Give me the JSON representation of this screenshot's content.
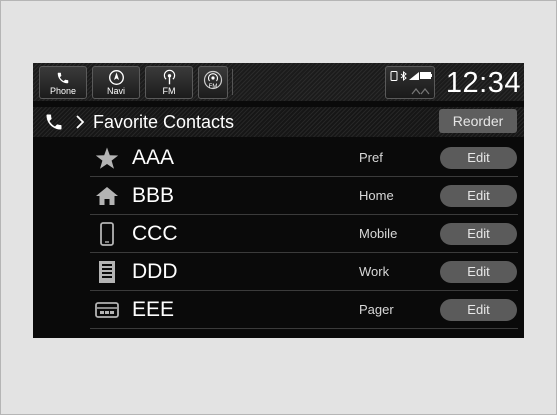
{
  "topbar": {
    "apps": [
      {
        "label": "Phone",
        "icon": "phone-icon"
      },
      {
        "label": "Navi",
        "icon": "navi-icon"
      },
      {
        "label": "FM",
        "icon": "radio-icon"
      },
      {
        "label": "FM",
        "icon": "radio-icon"
      }
    ],
    "status_icons": [
      "bluetooth-icon",
      "signal-icon",
      "battery-icon"
    ],
    "clock": "12:34"
  },
  "header": {
    "title": "Favorite Contacts",
    "reorder_label": "Reorder"
  },
  "contacts": [
    {
      "name": "AAA",
      "type": "Pref",
      "icon": "star-icon",
      "edit": "Edit"
    },
    {
      "name": "BBB",
      "type": "Home",
      "icon": "home-icon",
      "edit": "Edit"
    },
    {
      "name": "CCC",
      "type": "Mobile",
      "icon": "mobile-icon",
      "edit": "Edit"
    },
    {
      "name": "DDD",
      "type": "Work",
      "icon": "work-building-icon",
      "edit": "Edit"
    },
    {
      "name": "EEE",
      "type": "Pager",
      "icon": "pager-icon",
      "edit": "Edit"
    }
  ],
  "colors": {
    "screen_bg": "#0a0a0a",
    "button_bg": "#5b5b5b",
    "icon_gray": "#b4b4b4",
    "text": "#ffffff"
  }
}
